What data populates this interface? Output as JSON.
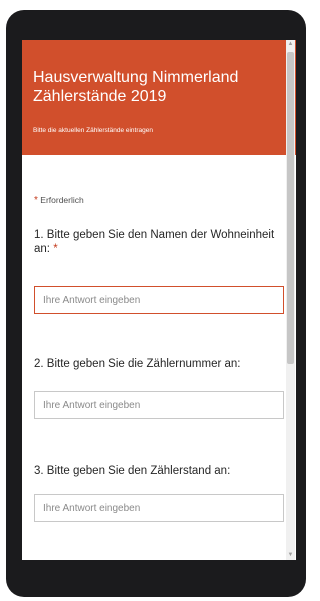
{
  "form": {
    "title": "Hausverwaltung Nimmerland Zählerstände 2019",
    "subtitle": "Bitte die aktuellen Zählerstände eintragen",
    "required_mark": "*",
    "required_note": "Erforderlich",
    "questions": [
      {
        "label": "1. Bitte geben Sie den Namen der Wohneinheit an:",
        "required": "*",
        "placeholder": "Ihre Antwort eingeben",
        "value": ""
      },
      {
        "label": "2. Bitte geben Sie die Zählernummer an:",
        "placeholder": "Ihre Antwort eingeben",
        "value": ""
      },
      {
        "label": "3. Bitte geben Sie den Zählerstand an:",
        "placeholder": "Ihre Antwort eingeben",
        "value": ""
      }
    ]
  },
  "scrollbar": {
    "up_icon": "triangle-up",
    "down_icon": "triangle-down"
  },
  "colors": {
    "header": "#d14f2c",
    "required": "#c43b1d",
    "device": "#1b1b1d"
  }
}
